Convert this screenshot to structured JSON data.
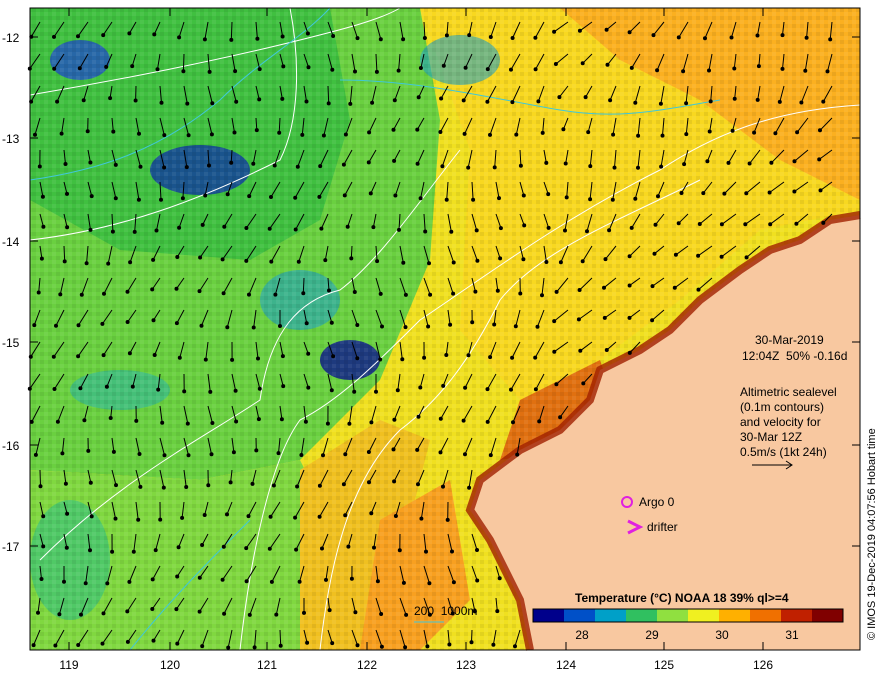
{
  "map": {
    "lat_ticks": [
      "-12",
      "-13",
      "-14",
      "-15",
      "-16",
      "-17"
    ],
    "lon_ticks": [
      "119",
      "120",
      "121",
      "122",
      "123",
      "124",
      "125",
      "126"
    ]
  },
  "info": {
    "date": "30-Mar-2019",
    "time_line": "12:04Z  50% -0.16d",
    "altimetric_lines": [
      "Altimetric sealevel",
      "(0.1m contours)",
      "and velocity for",
      "30-Mar 12Z",
      "0.5m/s (1kt 24h)"
    ],
    "argo_label": "Argo 0",
    "drifter_label": "drifter",
    "bathy_label": "200  1000m",
    "credit": "© IMOS 19-Dec-2019 04:07:56 Hobart time"
  },
  "colorbar": {
    "title": "Temperature (°C) NOAA 18 39% ql>=4",
    "ticks": [
      "28",
      "29",
      "30",
      "31"
    ],
    "colors": [
      "#00008b",
      "#0050c8",
      "#00a0c8",
      "#30c060",
      "#90e040",
      "#f0f020",
      "#ffb000",
      "#f07000",
      "#c02000",
      "#800000"
    ]
  },
  "colors": {
    "land": "#f8c8a0",
    "marker": "#e020e0"
  }
}
